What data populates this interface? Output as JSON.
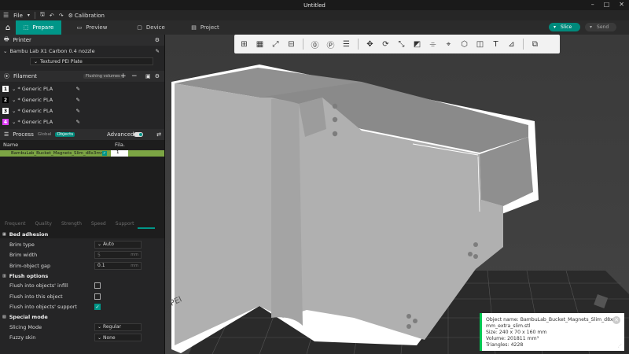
{
  "window": {
    "title": "Untitled"
  },
  "menu": {
    "file_label": "File",
    "calibration_label": "Calibration"
  },
  "tabs": [
    {
      "label": "Prepare",
      "active": true
    },
    {
      "label": "Preview",
      "active": false
    },
    {
      "label": "Device",
      "active": false
    },
    {
      "label": "Project",
      "active": false
    }
  ],
  "actions": {
    "slice_label": "Slice",
    "send_label": "Send"
  },
  "printer": {
    "section_label": "Printer",
    "model": "Bambu Lab X1 Carbon 0.4 nozzle",
    "plate": "Textured PEI Plate"
  },
  "filament": {
    "section_label": "Filament",
    "flushing_label": "Flushing volumes",
    "slots": [
      {
        "num": "1",
        "name": "* Generic PLA",
        "color": "#ffffff"
      },
      {
        "num": "2",
        "name": "* Generic PLA",
        "color": "#000000"
      },
      {
        "num": "3",
        "name": "* Generic PLA",
        "color": "#ffffff"
      },
      {
        "num": "4",
        "name": "* Generic PLA",
        "color": "#e040fb"
      }
    ]
  },
  "process": {
    "section_label": "Process",
    "global_label": "Global",
    "objects_label": "Objects",
    "advanced_label": "Advanced",
    "col_name": "Name",
    "col_fila": "Fila.",
    "object_name": "BambuLab_Bucket_Magnets_Slim_d8x3mm",
    "object_fila": "1"
  },
  "setting_tabs": [
    "Frequent",
    "Quality",
    "Strength",
    "Speed",
    "Support"
  ],
  "bed_adhesion": {
    "title": "Bed adhesion",
    "brim_type_label": "Brim type",
    "brim_type_value": "Auto",
    "brim_width_label": "Brim width",
    "brim_width_value": "5",
    "brim_width_unit": "mm",
    "brim_gap_label": "Brim-object gap",
    "brim_gap_value": "0.1",
    "brim_gap_unit": "mm"
  },
  "flush_options": {
    "title": "Flush options",
    "infill_label": "Flush into objects' infill",
    "object_label": "Flush into this object",
    "support_label": "Flush into objects' support"
  },
  "special_mode": {
    "title": "Special mode",
    "slicing_label": "Slicing Mode",
    "slicing_value": "Regular",
    "fuzzy_label": "Fuzzy skin",
    "fuzzy_value": "None"
  },
  "info": {
    "line1": "Object name: BambuLab_Bucket_Magnets_Slim_d8x3",
    "line2": "mm_extra_slim.stl",
    "line3": "Size: 240 x 70 x 160 mm",
    "line4": "Volume: 201811 mm³",
    "line5": "Triangles: 4228"
  },
  "colors": {
    "accent": "#009688",
    "info_border": "#00c853"
  }
}
